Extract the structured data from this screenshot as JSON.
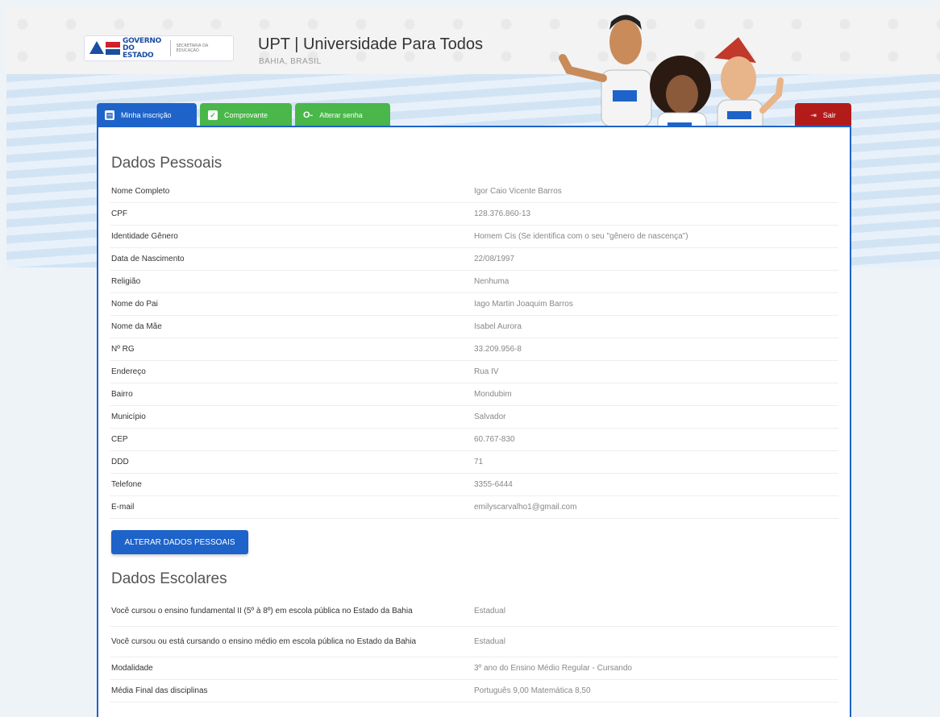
{
  "header": {
    "gov_line1": "GOVERNO",
    "gov_line2": "DO ESTADO",
    "gov_sub": "SECRETARIA DA EDUCAÇÃO",
    "title": "UPT | Universidade Para Todos",
    "subtitle": "BAHIA, BRASIL"
  },
  "tabs": {
    "minha": "Minha inscrição",
    "comprovante": "Comprovante",
    "senha": "Alterar senha",
    "sair": "Sair"
  },
  "pessoais": {
    "title": "Dados Pessoais",
    "rows": [
      {
        "label": "Nome Completo",
        "value": "Igor Caio Vicente Barros"
      },
      {
        "label": "CPF",
        "value": "128.376.860-13"
      },
      {
        "label": "Identidade Gênero",
        "value": "Homem Cis (Se identifica com o seu \"gênero de nascença\")"
      },
      {
        "label": "Data de Nascimento",
        "value": "22/08/1997"
      },
      {
        "label": "Religião",
        "value": "Nenhuma"
      },
      {
        "label": "Nome do Pai",
        "value": "Iago Martin Joaquim Barros"
      },
      {
        "label": "Nome da Mãe",
        "value": "Isabel Aurora"
      },
      {
        "label": "Nº RG",
        "value": "33.209.956-8"
      },
      {
        "label": "Endereço",
        "value": "Rua IV"
      },
      {
        "label": "Bairro",
        "value": "Mondubim"
      },
      {
        "label": "Município",
        "value": "Salvador"
      },
      {
        "label": "CEP",
        "value": "60.767-830"
      },
      {
        "label": "DDD",
        "value": "71"
      },
      {
        "label": "Telefone",
        "value": "3355-6444"
      },
      {
        "label": "E-mail",
        "value": "emilyscarvalho1@gmail.com"
      }
    ],
    "button": "ALTERAR DADOS PESSOAIS"
  },
  "escolares": {
    "title": "Dados Escolares",
    "rows": [
      {
        "label": "Você cursou o ensino fundamental II (5º à 8º) em escola pública no Estado da Bahia",
        "value": "Estadual"
      },
      {
        "label": "Você cursou ou está cursando o ensino médio em escola pública no Estado da Bahia",
        "value": "Estadual"
      },
      {
        "label": "Modalidade",
        "value": "3º ano do Ensino Médio Regular - Cursando"
      },
      {
        "label": "Média Final das disciplinas",
        "value": "Português 9,00 Matemática 8,50"
      }
    ]
  }
}
